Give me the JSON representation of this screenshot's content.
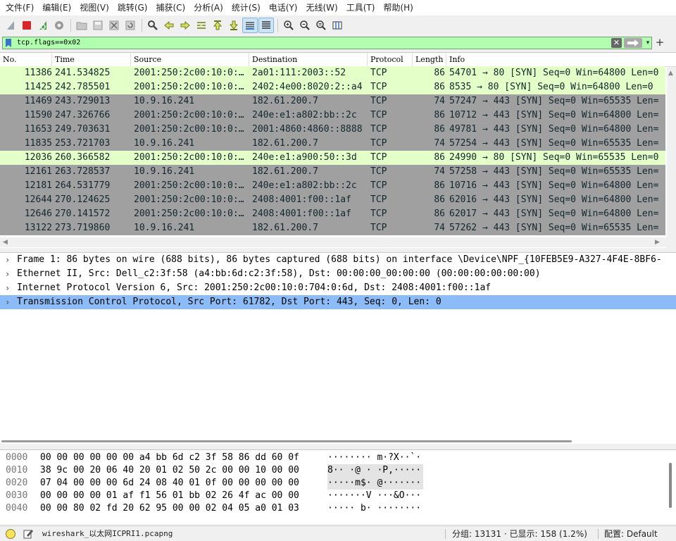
{
  "menu": [
    "文件(F)",
    "编辑(E)",
    "视图(V)",
    "跳转(G)",
    "捕获(C)",
    "分析(A)",
    "统计(S)",
    "电话(Y)",
    "无线(W)",
    "工具(T)",
    "帮助(H)"
  ],
  "filter": {
    "value": "tcp.flags==0x02",
    "clear_glyph": "✕",
    "apply_glyph": "→",
    "dropdown_glyph": "▾",
    "add_glyph": "+"
  },
  "packet_list": {
    "columns": [
      "No.",
      "Time",
      "Source",
      "Destination",
      "Protocol",
      "Length",
      "Info"
    ],
    "rows": [
      {
        "no": "11386",
        "time": "241.534825",
        "src": "2001:250:2c00:10:0:…",
        "dst": "2a01:111:2003::52",
        "proto": "TCP",
        "len": "86",
        "info": "54701 → 80 [SYN] Seq=0 Win=64800 Len=0",
        "color": "green"
      },
      {
        "no": "11425",
        "time": "242.785501",
        "src": "2001:250:2c00:10:0:…",
        "dst": "2402:4e00:8020:2::a4",
        "proto": "TCP",
        "len": "86",
        "info": "8535 → 80 [SYN] Seq=0 Win=64800 Len=0",
        "color": "green"
      },
      {
        "no": "11469",
        "time": "243.729013",
        "src": "10.9.16.241",
        "dst": "182.61.200.7",
        "proto": "TCP",
        "len": "74",
        "info": "57247 → 443 [SYN] Seq=0 Win=65535 Len=",
        "color": "gray"
      },
      {
        "no": "11590",
        "time": "247.326766",
        "src": "2001:250:2c00:10:0:…",
        "dst": "240e:e1:a802:bb::2c",
        "proto": "TCP",
        "len": "86",
        "info": "10712 → 443 [SYN] Seq=0 Win=64800 Len=",
        "color": "gray"
      },
      {
        "no": "11653",
        "time": "249.703631",
        "src": "2001:250:2c00:10:0:…",
        "dst": "2001:4860:4860::8888",
        "proto": "TCP",
        "len": "86",
        "info": "49781 → 443 [SYN] Seq=0 Win=64800 Len=",
        "color": "gray"
      },
      {
        "no": "11835",
        "time": "253.721703",
        "src": "10.9.16.241",
        "dst": "182.61.200.7",
        "proto": "TCP",
        "len": "74",
        "info": "57254 → 443 [SYN] Seq=0 Win=65535 Len=",
        "color": "gray"
      },
      {
        "no": "12036",
        "time": "260.366582",
        "src": "2001:250:2c00:10:0:…",
        "dst": "240e:e1:a900:50::3d",
        "proto": "TCP",
        "len": "86",
        "info": "24990 → 80 [SYN] Seq=0 Win=65535 Len=0",
        "color": "green"
      },
      {
        "no": "12161",
        "time": "263.728537",
        "src": "10.9.16.241",
        "dst": "182.61.200.7",
        "proto": "TCP",
        "len": "74",
        "info": "57258 → 443 [SYN] Seq=0 Win=65535 Len=",
        "color": "gray"
      },
      {
        "no": "12181",
        "time": "264.531779",
        "src": "2001:250:2c00:10:0:…",
        "dst": "240e:e1:a802:bb::2c",
        "proto": "TCP",
        "len": "86",
        "info": "10716 → 443 [SYN] Seq=0 Win=64800 Len=",
        "color": "gray"
      },
      {
        "no": "12644",
        "time": "270.124625",
        "src": "2001:250:2c00:10:0:…",
        "dst": "2408:4001:f00::1af",
        "proto": "TCP",
        "len": "86",
        "info": "62016 → 443 [SYN] Seq=0 Win=64800 Len=",
        "color": "gray"
      },
      {
        "no": "12646",
        "time": "270.141572",
        "src": "2001:250:2c00:10:0:…",
        "dst": "2408:4001:f00::1af",
        "proto": "TCP",
        "len": "86",
        "info": "62017 → 443 [SYN] Seq=0 Win=64800 Len=",
        "color": "gray"
      },
      {
        "no": "13122",
        "time": "273.719860",
        "src": "10.9.16.241",
        "dst": "182.61.200.7",
        "proto": "TCP",
        "len": "74",
        "info": "57262 → 443 [SYN] Seq=0 Win=65535 Len=",
        "color": "gray"
      }
    ]
  },
  "details": [
    {
      "text": "Frame 1: 86 bytes on wire (688 bits), 86 bytes captured (688 bits) on interface \\Device\\NPF_{10FEB5E9-A327-4F4E-8BF6-",
      "selected": false
    },
    {
      "text": "Ethernet II, Src: Dell_c2:3f:58 (a4:bb:6d:c2:3f:58), Dst: 00:00:00_00:00:00 (00:00:00:00:00:00)",
      "selected": false
    },
    {
      "text": "Internet Protocol Version 6, Src: 2001:250:2c00:10:0:704:0:6d, Dst: 2408:4001:f00::1af",
      "selected": false
    },
    {
      "text": "Transmission Control Protocol, Src Port: 61782, Dst Port: 443, Seq: 0, Len: 0",
      "selected": true
    }
  ],
  "hex": [
    {
      "offset": "0000",
      "bytes": "00 00 00 00 00 00 a4 bb  6d c2 3f 58 86 dd 60 0f",
      "ascii": "········ m·?X··`·",
      "hl": false
    },
    {
      "offset": "0010",
      "bytes": "38 9c 00 20 06 40 20 01  02 50 2c 00 00 10 00 00",
      "ascii": "8·· ·@ · ·P,·····",
      "hl": true
    },
    {
      "offset": "0020",
      "bytes": "07 04 00 00 00 6d 24 08  40 01 0f 00 00 00 00 00",
      "ascii": "·····m$· @·······",
      "hl": true
    },
    {
      "offset": "0030",
      "bytes": "00 00 00 00 01 af f1 56  01 bb 02 26 4f ac 00 00",
      "ascii": "·······V ···&O···",
      "hl": false
    },
    {
      "offset": "0040",
      "bytes": "00 00 80 02 fd 20 62 95  00 00 02 04 05 a0 01 03",
      "ascii": "····· b· ········",
      "hl": false
    }
  ],
  "status": {
    "file": "wireshark_以太网ICPRI1.pcapng",
    "stats": "分组: 13131 · 已显示: 158 (1.2%)",
    "profile": "配置: Default"
  }
}
